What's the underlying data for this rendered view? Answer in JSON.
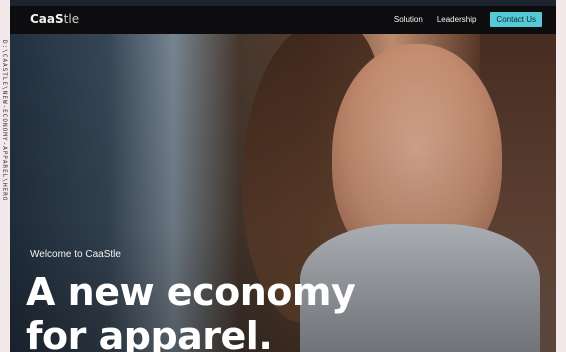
{
  "side_strip_text": "D:\\CAASTLE\\NEW-ECONOMY-APPAREL\\HERO",
  "header": {
    "logo_bold": "CaaS",
    "logo_light": "tle",
    "nav": [
      {
        "label": "Solution"
      },
      {
        "label": "Leadership"
      }
    ],
    "contact_label": "Contact Us"
  },
  "hero": {
    "welcome": "Welcome to CaaStle",
    "headline_line1": "A new economy",
    "headline_line2": "for apparel."
  },
  "colors": {
    "accent": "#56c9d6",
    "topbar": "#0d0d0f",
    "page_bg": "#f3e8ea"
  }
}
